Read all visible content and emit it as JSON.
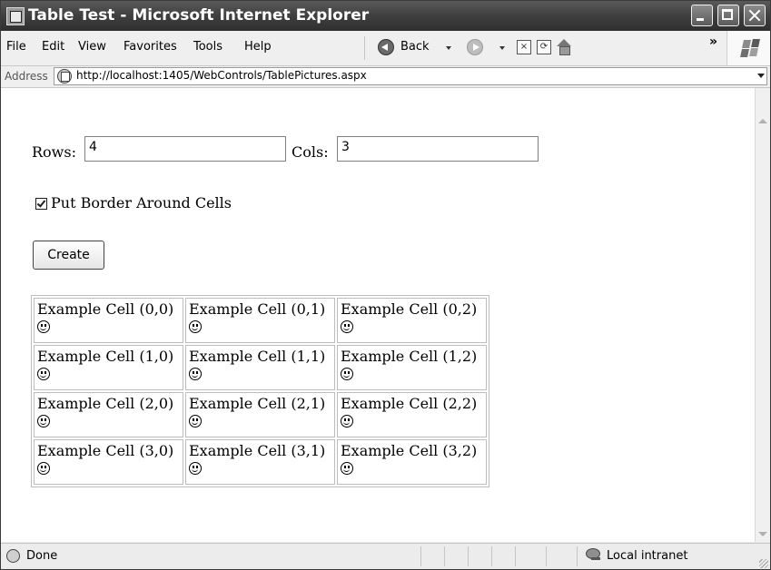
{
  "window": {
    "title": "Table Test - Microsoft Internet Explorer"
  },
  "menu": [
    "File",
    "Edit",
    "View",
    "Favorites",
    "Tools",
    "Help"
  ],
  "toolbar": {
    "back_label": "Back",
    "more": "»"
  },
  "address": {
    "label": "Address",
    "url": "http://localhost:1405/WebControls/TablePictures.aspx"
  },
  "form": {
    "rows_label": "Rows:",
    "rows_value": "4",
    "cols_label": "Cols:",
    "cols_value": "3",
    "border_checkbox_label": "Put Border Around Cells",
    "border_checked": true,
    "create_button": "Create"
  },
  "table": {
    "rows": [
      [
        "Example Cell (0,0)",
        "Example Cell (0,1)",
        "Example Cell (0,2)"
      ],
      [
        "Example Cell (1,0)",
        "Example Cell (1,1)",
        "Example Cell (1,2)"
      ],
      [
        "Example Cell (2,0)",
        "Example Cell (2,1)",
        "Example Cell (2,2)"
      ],
      [
        "Example Cell (3,0)",
        "Example Cell (3,1)",
        "Example Cell (3,2)"
      ]
    ],
    "cell_icon": "smiley-icon"
  },
  "status": {
    "text": "Done",
    "zone": "Local intranet"
  }
}
